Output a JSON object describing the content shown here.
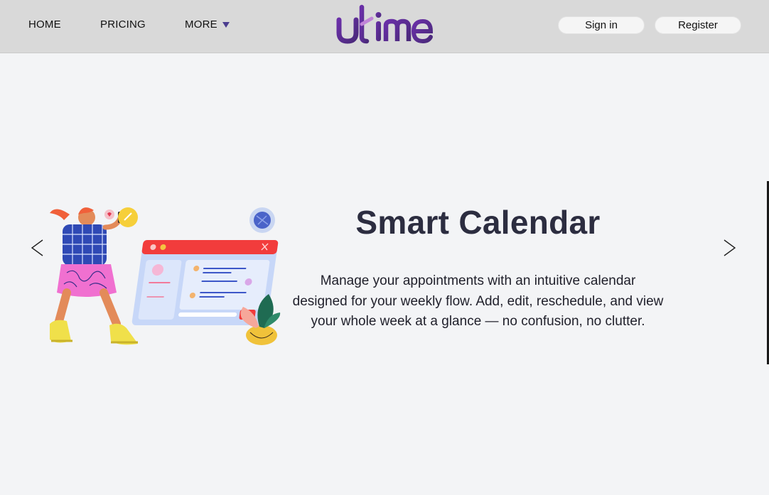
{
  "nav": {
    "home": "HOME",
    "pricing": "PRICING",
    "more": "MORE",
    "sign_in": "Sign in",
    "register": "Register"
  },
  "logo": {
    "text": "utime",
    "color": "#5b2d8e"
  },
  "hero": {
    "title": "Smart Calendar",
    "description": "Manage your appointments with an intuitive calendar designed for your weekly flow. Add, edit, reschedule, and view your whole week at a glance — no confusion, no clutter."
  },
  "icons": {
    "prev": "chevron-left-icon",
    "next": "chevron-right-icon",
    "dropdown": "caret-down-icon"
  },
  "colors": {
    "navbar": "#d9d9d9",
    "background": "#f3f4f6",
    "accent": "#4b3d8f",
    "window_header": "#f23c3c"
  }
}
